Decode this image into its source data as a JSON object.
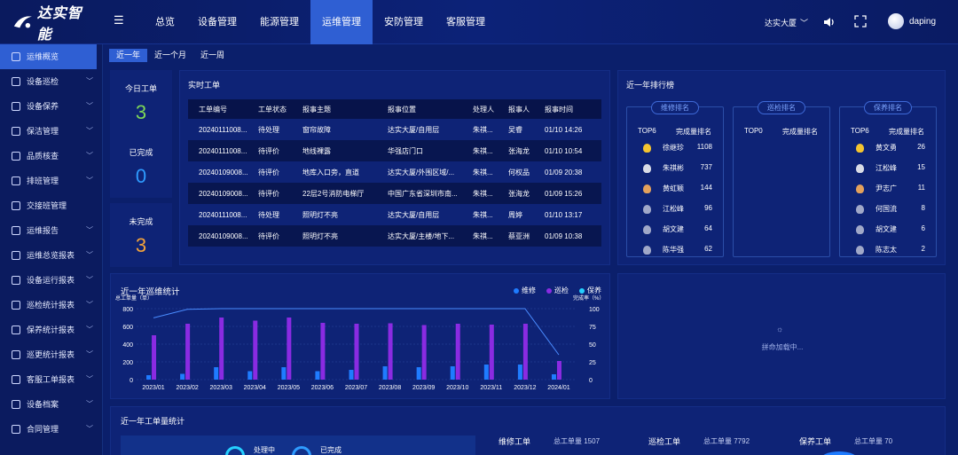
{
  "app": {
    "logo_text": "达实智能"
  },
  "nav": [
    "总览",
    "设备管理",
    "能源管理",
    "运维管理",
    "安防管理",
    "客服管理"
  ],
  "nav_active": 3,
  "header": {
    "site": "达实大厦",
    "user": "daping"
  },
  "sidebar": [
    {
      "label": "运维概览",
      "icon": "monitor-icon",
      "arrow": false
    },
    {
      "label": "设备巡检",
      "icon": "inspect-icon",
      "arrow": true
    },
    {
      "label": "设备保养",
      "icon": "maintain-icon",
      "arrow": true
    },
    {
      "label": "保洁管理",
      "icon": "clean-icon",
      "arrow": true
    },
    {
      "label": "品质核查",
      "icon": "quality-icon",
      "arrow": true
    },
    {
      "label": "排班管理",
      "icon": "schedule-icon",
      "arrow": true
    },
    {
      "label": "交接班管理",
      "icon": "handover-icon",
      "arrow": false
    },
    {
      "label": "运维报告",
      "icon": "report-icon",
      "arrow": true
    },
    {
      "label": "运维总览报表",
      "icon": "report-icon",
      "arrow": true
    },
    {
      "label": "设备运行报表",
      "icon": "report-icon",
      "arrow": true
    },
    {
      "label": "巡检统计报表",
      "icon": "report-icon",
      "arrow": true
    },
    {
      "label": "保养统计报表",
      "icon": "report-icon",
      "arrow": true
    },
    {
      "label": "巡更统计报表",
      "icon": "report-icon",
      "arrow": true
    },
    {
      "label": "客服工单报表",
      "icon": "report-icon",
      "arrow": true
    },
    {
      "label": "设备档案",
      "icon": "archive-icon",
      "arrow": true
    },
    {
      "label": "合同管理",
      "icon": "contract-icon",
      "arrow": true
    }
  ],
  "period_tabs": [
    "近一年",
    "近一个月",
    "近一周"
  ],
  "kpis": [
    {
      "label": "今日工单",
      "value": "3",
      "color": "#7ed957"
    },
    {
      "label": "已完成",
      "value": "0",
      "color": "#2e9bff"
    },
    {
      "label": "未完成",
      "value": "3",
      "color": "#f5a43a"
    }
  ],
  "realtime": {
    "title": "实时工单",
    "columns": [
      "工单编号",
      "工单状态",
      "报事主题",
      "报事位置",
      "处理人",
      "报事人",
      "报事时间"
    ],
    "rows": [
      [
        "20240111008...",
        "待处理",
        "窗帘故障",
        "达实大厦/自用层",
        "朱祺...",
        "吴睿",
        "01/10 14:26"
      ],
      [
        "20240111008...",
        "待评价",
        "地线裸露",
        "华强店门口",
        "朱祺...",
        "张海龙",
        "01/10 10:54"
      ],
      [
        "20240109008...",
        "待评价",
        "地库入口旁，直道",
        "达实大厦/外围区域/...",
        "朱祺...",
        "何权品",
        "01/09 20:38"
      ],
      [
        "20240109008...",
        "待评价",
        "22层2号消防电梯厅",
        "中国广东省深圳市南...",
        "朱祺...",
        "张海龙",
        "01/09 15:26"
      ],
      [
        "20240111008...",
        "待处理",
        "照明灯不亮",
        "达实大厦/自用层",
        "朱祺...",
        "周婷",
        "01/10 13:17"
      ],
      [
        "20240109008...",
        "待评价",
        "照明灯不亮",
        "达实大厦/主楼/地下...",
        "朱祺...",
        "蔡亚洲",
        "01/09 10:38"
      ]
    ]
  },
  "ranking": {
    "title": "近一年排行榜",
    "boxes": [
      {
        "pill": "维修排名",
        "top": "TOP6",
        "col": "完成量排名",
        "rows": [
          [
            "徐继珍",
            "1108"
          ],
          [
            "朱祺彬",
            "737"
          ],
          [
            "黄虹颖",
            "144"
          ],
          [
            "江松峰",
            "96"
          ],
          [
            "胡文建",
            "64"
          ],
          [
            "陈华强",
            "62"
          ]
        ]
      },
      {
        "pill": "巡检排名",
        "top": "TOP0",
        "col": "完成量排名",
        "rows": []
      },
      {
        "pill": "保养排名",
        "top": "TOP6",
        "col": "完成量排名",
        "rows": [
          [
            "黄文勇",
            "26"
          ],
          [
            "江松峰",
            "15"
          ],
          [
            "尹志广",
            "11"
          ],
          [
            "何国流",
            "8"
          ],
          [
            "胡文建",
            "6"
          ],
          [
            "陈志太",
            "2"
          ]
        ]
      }
    ]
  },
  "chart_data": {
    "type": "bar",
    "title": "近一年巡维统计",
    "ylabel_left": "总工单量（单）",
    "ylabel_right": "完成率（%）",
    "categories": [
      "2023/01",
      "2023/02",
      "2023/03",
      "2023/04",
      "2023/05",
      "2023/06",
      "2023/07",
      "2023/08",
      "2023/09",
      "2023/10",
      "2023/11",
      "2023/12",
      "2024/01"
    ],
    "ylim": [
      0,
      800
    ],
    "y_ticks": [
      "800",
      "600",
      "400",
      "200",
      "0"
    ],
    "y2lim": [
      0,
      100
    ],
    "y2_ticks": [
      "100",
      "75",
      "50",
      "25",
      "0"
    ],
    "series": [
      {
        "name": "维修",
        "color": "#1f7cff",
        "values": [
          50,
          65,
          140,
          95,
          140,
          95,
          110,
          150,
          140,
          150,
          170,
          170,
          60
        ]
      },
      {
        "name": "巡检",
        "color": "#8a2be2",
        "values": [
          500,
          630,
          700,
          665,
          700,
          640,
          630,
          635,
          615,
          630,
          620,
          630,
          210
        ]
      },
      {
        "name": "保养",
        "color": "#25d0ff",
        "values": [
          0,
          0,
          0,
          0,
          0,
          0,
          0,
          0,
          0,
          0,
          0,
          0,
          0
        ]
      }
    ],
    "line": {
      "name": "完成率",
      "color": "#4a8cff",
      "values": [
        87,
        99,
        100,
        100,
        100,
        100,
        100,
        100,
        100,
        100,
        100,
        100,
        35
      ]
    }
  },
  "loading_text": "拼命加载中...",
  "bottom": {
    "title": "近一年工单量统计",
    "processing": "处理中",
    "done": "已完成",
    "items": [
      {
        "label": "维修工单",
        "sub": "总工单量 1507"
      },
      {
        "label": "巡检工单",
        "sub": "总工单量 7792"
      },
      {
        "label": "保养工单",
        "sub": "总工单量 70"
      }
    ]
  }
}
